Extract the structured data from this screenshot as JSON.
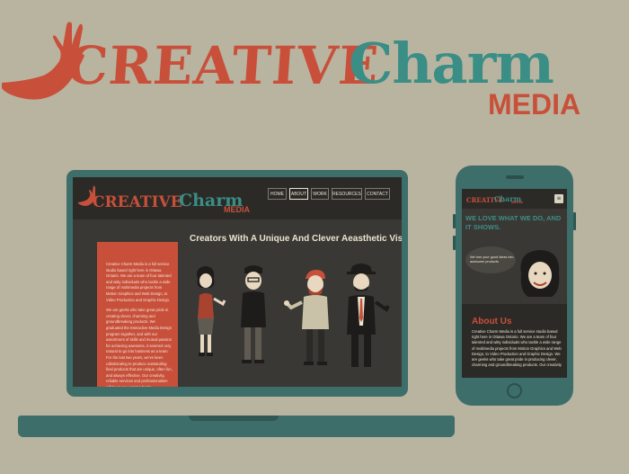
{
  "logo": {
    "creative": "CREATIVE",
    "charm": "Charm",
    "media": "MEDIA"
  },
  "laptop": {
    "logo": {
      "creative": "CREATIVE",
      "charm": "Charm",
      "media": "MEDIA"
    },
    "nav": [
      "HOME",
      "ABOUT",
      "WORK",
      "RESOURCES",
      "CONTACT"
    ],
    "headline": "Creators With A Unique And Clever Aeasthetic Vision",
    "sidebar_paragraphs": [
      "Creative Charm Media is a full service studio based right here in Ottawa Ontario. We are a team of four talented and witty individuals who tackle a wide range of multimedia projects from Motion Graphics and Web Design, to Video Production and Graphic Design.",
      "We are geeks who take great pride in creating clever, charming and groundbreaking products. We graduated the Interactive Media Design program together, and with our assortment of skills and mutual passion for achieving awesome, it seemed very natural to go into business as a team. For the last two years, we've been collaborating to produce outstanding final products that are unique, often fun, and always effective. Our creativity, reliable services and professionalism will keep you coming back!"
    ]
  },
  "phone": {
    "logo": {
      "creative": "CREATIVE",
      "charm": "Charm",
      "media": "MEDIA"
    },
    "menu_icon": "≡",
    "tagline": "WE LOVE WHAT WE DO, AND IT SHOWS.",
    "bubble_text": "We turn your good ideas into awesome products",
    "about_heading": "About Us",
    "about_text": "Creative Charm Media is a full service studio based right here in Ottawa Ontario. We are a team of four talented and witty individuals who tackle a wide range of multimedia projects from Motion Graphics and Web Design, to Video Production and Graphic Design. We are geeks who take great pride in producing clever, charming and groundbreaking products. Our creativity"
  },
  "colors": {
    "background": "#b9b4a0",
    "red": "#c8503a",
    "teal": "#3a8e86",
    "device": "#3d6e6a",
    "screen": "#3a3834"
  }
}
